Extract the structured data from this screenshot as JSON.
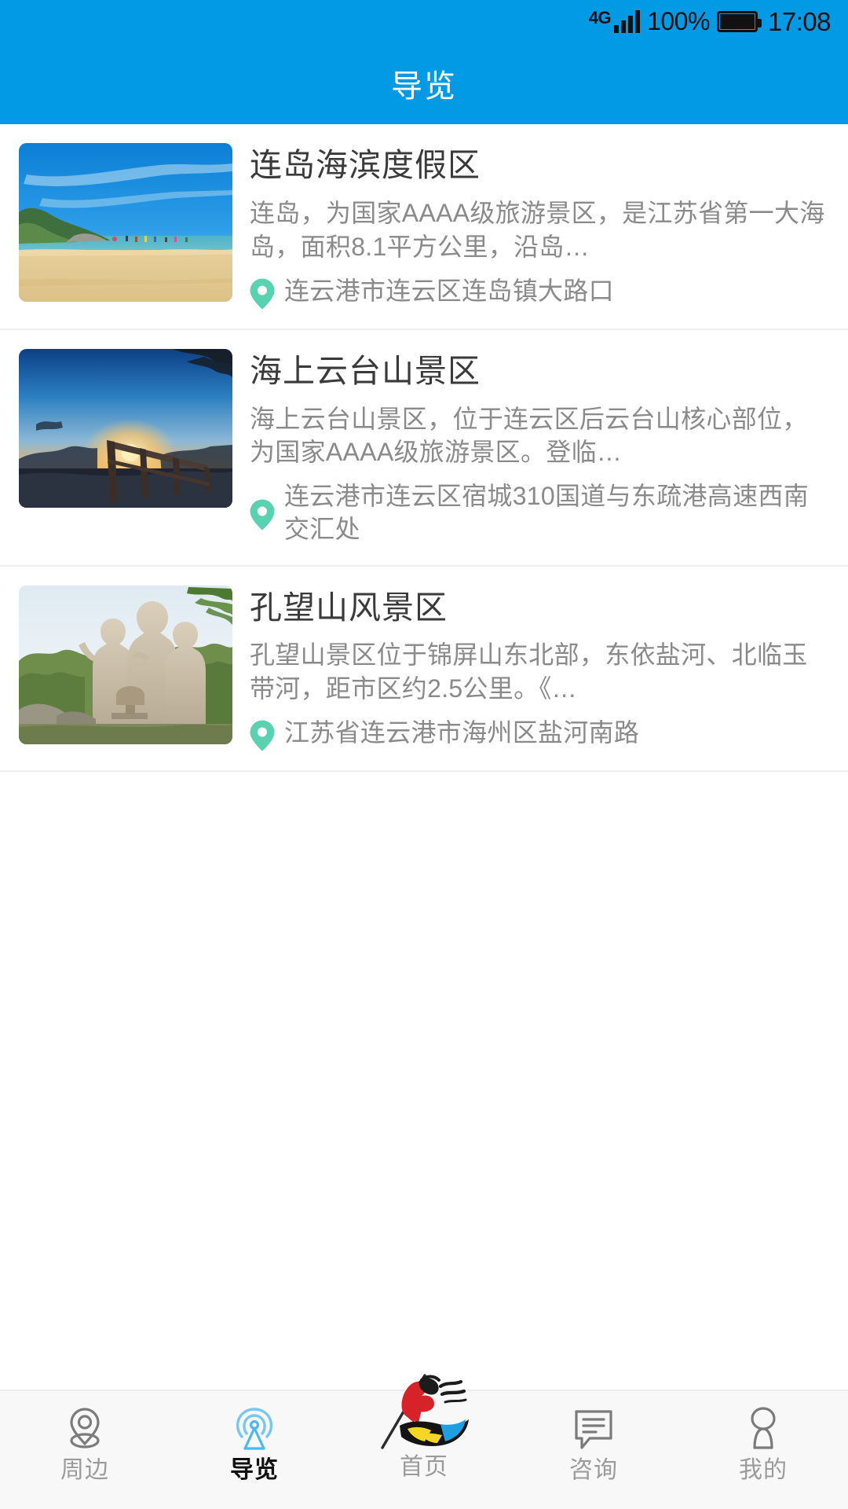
{
  "status_bar": {
    "network_type": "4G",
    "battery_percent": "100%",
    "time": "17:08"
  },
  "app_bar": {
    "title": "导览"
  },
  "theme": {
    "primary_blue": "#039ae5",
    "accent_pin_green": "#5ad1b0",
    "title_gray": "#3a3a3a",
    "body_gray": "#8a8a8a",
    "nav_inactive": "#9b9b9b",
    "nav_active": "#111111",
    "nav_active_icon": "#4cb8f0"
  },
  "list": {
    "items": [
      {
        "title": "连岛海滨度假区",
        "description": "连岛，为国家AAAA级旅游景区，是江苏省第一大海岛，面积8.1平方公里，沿岛…",
        "address": "连云港市连云区连岛镇大路口",
        "image_alt": "beach-thumbnail"
      },
      {
        "title": "海上云台山景区",
        "description": "海上云台山景区，位于连云区后云台山核心部位，为国家AAAA级旅游景区。登临…",
        "address": "连云港市连云区宿城310国道与东疏港高速西南交汇处",
        "image_alt": "sunset-mountain-thumbnail"
      },
      {
        "title": "孔望山风景区",
        "description": "孔望山景区位于锦屏山东北部，东依盐河、北临玉带河，距市区约2.5公里。《…",
        "address": "江苏省连云港市海州区盐河南路",
        "image_alt": "statue-thumbnail"
      }
    ]
  },
  "bottom_nav": {
    "items": [
      {
        "label": "周边",
        "icon": "map-pin-icon",
        "active": false
      },
      {
        "label": "导览",
        "icon": "broadcast-icon",
        "active": true
      },
      {
        "label": "首页",
        "icon": "app-logo-icon",
        "active": false
      },
      {
        "label": "咨询",
        "icon": "chat-bubble-icon",
        "active": false
      },
      {
        "label": "我的",
        "icon": "person-icon",
        "active": false
      }
    ]
  }
}
